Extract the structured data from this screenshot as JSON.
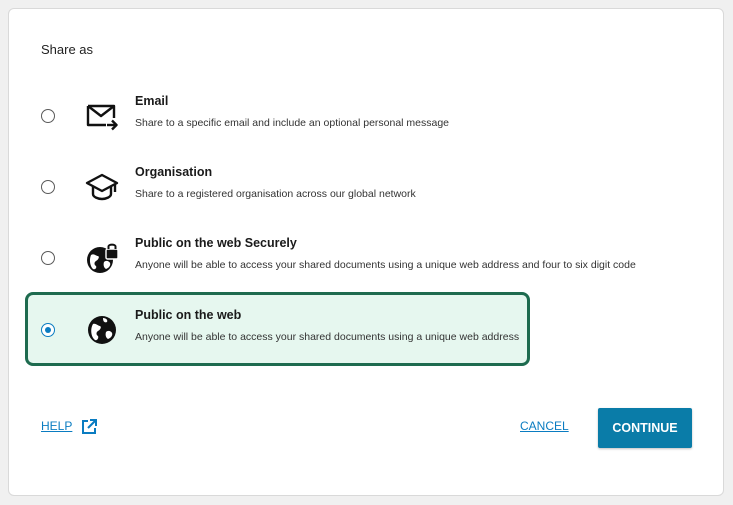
{
  "dialog": {
    "title": "Share as",
    "options": [
      {
        "title": "Email",
        "description": "Share to a specific email and include an optional personal message",
        "icon": "email-send-icon",
        "selected": false
      },
      {
        "title": "Organisation",
        "description": "Share to a registered organisation across our global network",
        "icon": "graduation-cap-icon",
        "selected": false
      },
      {
        "title": "Public on the web Securely",
        "description": "Anyone will be able to access your shared documents using a unique web address and four to six digit code",
        "icon": "globe-lock-icon",
        "selected": false
      },
      {
        "title": "Public on the web",
        "description": "Anyone will be able to access your shared documents using a unique web address",
        "icon": "globe-icon",
        "selected": true
      }
    ]
  },
  "footer": {
    "help_label": "HELP",
    "cancel_label": "CANCEL",
    "continue_label": "CONTINUE"
  },
  "colors": {
    "accent": "#0a7cc1",
    "button": "#0a7ca8",
    "selected_bg": "#e6f7ef",
    "selected_border": "#1e6b4f"
  }
}
